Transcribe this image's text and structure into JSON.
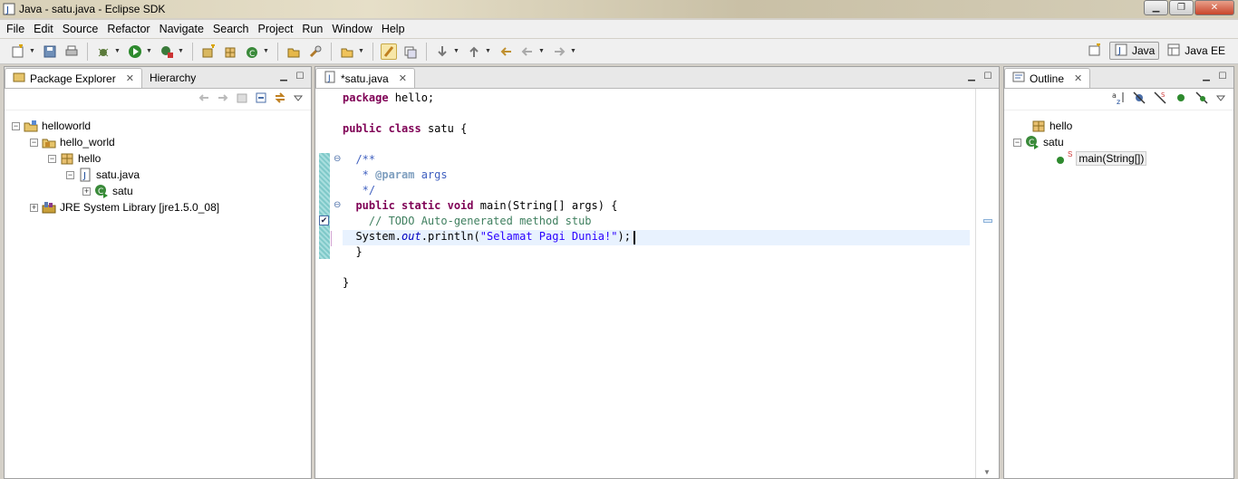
{
  "window": {
    "title": "Java - satu.java - Eclipse SDK"
  },
  "menu": [
    "File",
    "Edit",
    "Source",
    "Refactor",
    "Navigate",
    "Search",
    "Project",
    "Run",
    "Window",
    "Help"
  ],
  "perspectives": [
    {
      "label": "Java",
      "active": true
    },
    {
      "label": "Java EE",
      "active": false
    }
  ],
  "explorer": {
    "tabs": [
      "Package Explorer",
      "Hierarchy"
    ],
    "tree": [
      {
        "label": "helloworld",
        "icon": "project-icon",
        "depth": 0
      },
      {
        "label": "hello_world",
        "icon": "source-folder-icon",
        "depth": 1
      },
      {
        "label": "hello",
        "icon": "package-icon",
        "depth": 2
      },
      {
        "label": "satu.java",
        "icon": "java-file-icon",
        "depth": 3
      },
      {
        "label": "satu",
        "icon": "class-icon",
        "depth": 4
      },
      {
        "label": "JRE System Library [jre1.5.0_08]",
        "icon": "library-icon",
        "depth": 1
      }
    ]
  },
  "editor": {
    "tab": "*satu.java",
    "lines": {
      "l1_kw": "package",
      "l1_rest": " hello;",
      "l3_kw1": "public",
      "l3_kw2": "class",
      "l3_rest": " satu {",
      "l5": "  /**",
      "l6_pre": "   * ",
      "l6_tag": "@param",
      "l6_rest": " args",
      "l7": "   */",
      "l8_kw": "  public static void",
      "l8_rest": " main(String[] args) {",
      "l9": "    // TODO Auto-generated method stub",
      "l10_pre": "  System.",
      "l10_out": "out",
      "l10_mid": ".println(",
      "l10_str": "\"Selamat Pagi Dunia!\"",
      "l10_end": ");",
      "l11": "  }",
      "l13": "}"
    }
  },
  "outline": {
    "tab": "Outline",
    "items": [
      {
        "label": "hello",
        "icon": "package-icon"
      },
      {
        "label": "satu",
        "icon": "class-icon"
      },
      {
        "label": "main(String[])",
        "icon": "method-icon",
        "modifier": "S"
      }
    ]
  }
}
